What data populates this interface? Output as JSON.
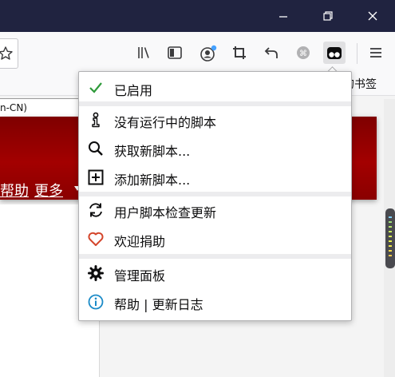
{
  "colors": {
    "titlebar": "#202340",
    "banner": "#a30000",
    "check": "#2e9a3a",
    "heart": "#d4462c",
    "info": "#1a8ac7",
    "badge": "#45a1ff"
  },
  "bookmarks": {
    "partial_label": "的书签"
  },
  "page": {
    "lang_fragment": "n-CN)",
    "nav_help": "帮助",
    "nav_more": "更多"
  },
  "toolbar": {
    "icons": [
      "library-icon",
      "sidebar-icon",
      "account-icon",
      "crop-icon",
      "undo-icon",
      "extension-icon",
      "tampermonkey-icon",
      "hamburger-menu-icon"
    ]
  },
  "menu": {
    "enabled": "已启用",
    "no_scripts": "没有运行中的脚本",
    "get_scripts": "获取新脚本...",
    "add_script": "添加新脚本...",
    "check_updates": "用户脚本检查更新",
    "donate": "欢迎捐助",
    "dashboard": "管理面板",
    "help_changelog": "帮助 | 更新日志"
  }
}
